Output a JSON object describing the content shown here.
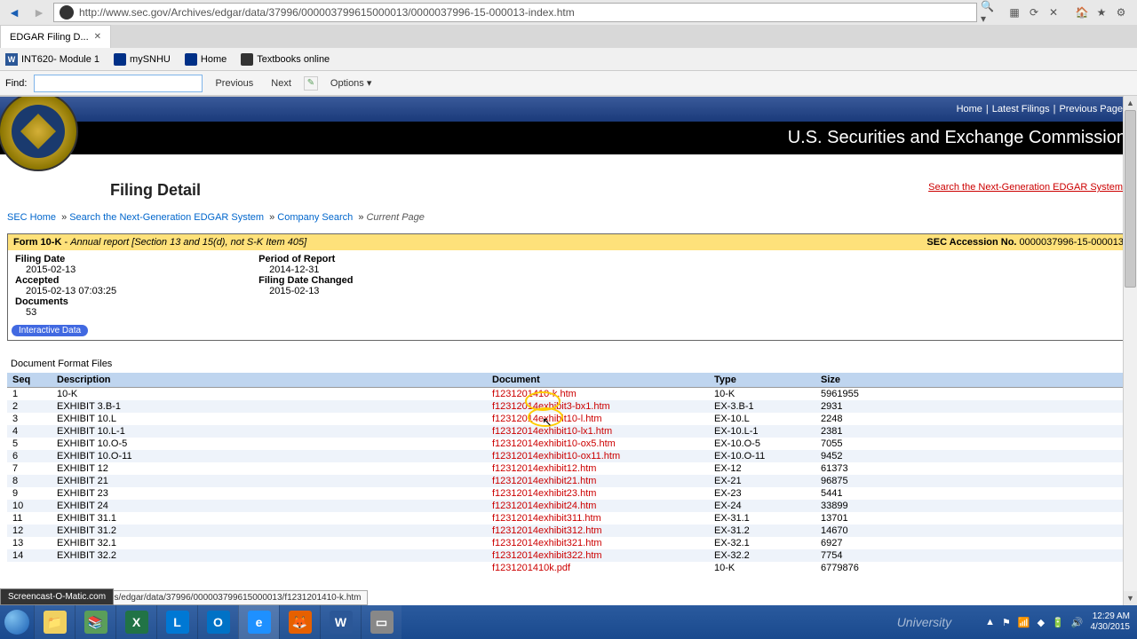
{
  "browser": {
    "url": "http://www.sec.gov/Archives/edgar/data/37996/000003799615000013/0000037996-15-000013-index.htm",
    "tab_title": "EDGAR Filing D..."
  },
  "bookmarks": [
    {
      "label": "INT620- Module 1",
      "icon": "word"
    },
    {
      "label": "mySNHU",
      "icon": "snhu"
    },
    {
      "label": "Home",
      "icon": "snhu"
    },
    {
      "label": "Textbooks online",
      "icon": "txt"
    }
  ],
  "findbar": {
    "label": "Find:",
    "prev": "Previous",
    "next": "Next",
    "options": "Options"
  },
  "header": {
    "top_links": [
      "Home",
      "Latest Filings",
      "Previous Page"
    ],
    "title": "U.S. Securities and Exchange Commission"
  },
  "page": {
    "title": "Filing Detail",
    "search_ng": "Search the Next-Generation EDGAR System",
    "breadcrumb": [
      {
        "text": "SEC Home",
        "link": true
      },
      {
        "text": "Search the Next-Generation EDGAR System",
        "link": true
      },
      {
        "text": "Company Search",
        "link": true
      },
      {
        "text": "Current Page",
        "link": false
      }
    ]
  },
  "filing": {
    "form_name": "Form 10-K",
    "form_desc": "Annual report [Section 13 and 15(d), not S-K Item 405]",
    "acc_label": "SEC Accession No.",
    "acc_value": "0000037996-15-000013",
    "fields": {
      "filing_date_label": "Filing Date",
      "filing_date": "2015-02-13",
      "accepted_label": "Accepted",
      "accepted": "2015-02-13 07:03:25",
      "documents_label": "Documents",
      "documents": "53",
      "period_label": "Period of Report",
      "period": "2014-12-31",
      "changed_label": "Filing Date Changed",
      "changed": "2015-02-13"
    },
    "interactive_label": "Interactive Data"
  },
  "doc_section": {
    "title": "Document Format Files",
    "cols": {
      "seq": "Seq",
      "desc": "Description",
      "doc": "Document",
      "type": "Type",
      "size": "Size"
    },
    "rows": [
      {
        "seq": "1",
        "desc": "10-K",
        "doc": "f1231201410-k.htm",
        "type": "10-K",
        "size": "5961955"
      },
      {
        "seq": "2",
        "desc": "EXHIBIT 3.B-1",
        "doc": "f12312014exhibit3-bx1.htm",
        "type": "EX-3.B-1",
        "size": "2931"
      },
      {
        "seq": "3",
        "desc": "EXHIBIT 10.L",
        "doc": "f12312014exhibit10-l.htm",
        "type": "EX-10.L",
        "size": "2248"
      },
      {
        "seq": "4",
        "desc": "EXHIBIT 10.L-1",
        "doc": "f12312014exhibit10-lx1.htm",
        "type": "EX-10.L-1",
        "size": "2381"
      },
      {
        "seq": "5",
        "desc": "EXHIBIT 10.O-5",
        "doc": "f12312014exhibit10-ox5.htm",
        "type": "EX-10.O-5",
        "size": "7055"
      },
      {
        "seq": "6",
        "desc": "EXHIBIT 10.O-11",
        "doc": "f12312014exhibit10-ox11.htm",
        "type": "EX-10.O-11",
        "size": "9452"
      },
      {
        "seq": "7",
        "desc": "EXHIBIT 12",
        "doc": "f12312014exhibit12.htm",
        "type": "EX-12",
        "size": "61373"
      },
      {
        "seq": "8",
        "desc": "EXHIBIT 21",
        "doc": "f12312014exhibit21.htm",
        "type": "EX-21",
        "size": "96875"
      },
      {
        "seq": "9",
        "desc": "EXHIBIT 23",
        "doc": "f12312014exhibit23.htm",
        "type": "EX-23",
        "size": "5441"
      },
      {
        "seq": "10",
        "desc": "EXHIBIT 24",
        "doc": "f12312014exhibit24.htm",
        "type": "EX-24",
        "size": "33899"
      },
      {
        "seq": "11",
        "desc": "EXHIBIT 31.1",
        "doc": "f12312014exhibit311.htm",
        "type": "EX-31.1",
        "size": "13701"
      },
      {
        "seq": "12",
        "desc": "EXHIBIT 31.2",
        "doc": "f12312014exhibit312.htm",
        "type": "EX-31.2",
        "size": "14670"
      },
      {
        "seq": "13",
        "desc": "EXHIBIT 32.1",
        "doc": "f12312014exhibit321.htm",
        "type": "EX-32.1",
        "size": "6927"
      },
      {
        "seq": "14",
        "desc": "EXHIBIT 32.2",
        "doc": "f12312014exhibit322.htm",
        "type": "EX-32.2",
        "size": "7754"
      },
      {
        "seq": "",
        "desc": "",
        "doc": "f1231201410k.pdf",
        "type": "10-K",
        "size": "6779876"
      }
    ]
  },
  "status_url": "http://www.sec.gov/Archives/edgar/data/37996/000003799615000013/f1231201410-k.htm",
  "som": "Screencast-O-Matic.com",
  "taskbar": {
    "brand": "University",
    "time": "12:29 AM",
    "date": "4/30/2015"
  }
}
